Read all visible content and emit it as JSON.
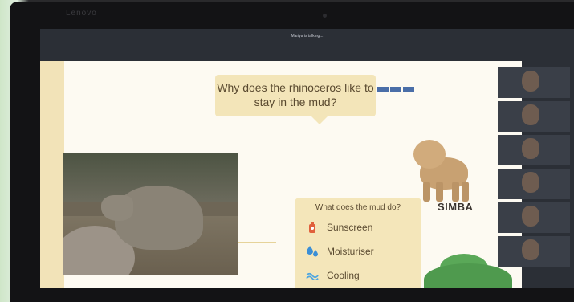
{
  "device": {
    "brand": "Lenovo"
  },
  "meeting": {
    "status": "Mariya is talking..."
  },
  "slide": {
    "question": "Why does the rhinoceros like to stay in the mud?",
    "character_name": "SIMBA",
    "card": {
      "heading": "What does the mud do?",
      "items": [
        {
          "icon": "sunscreen-bottle-icon",
          "label": "Sunscreen",
          "color": "#e0603c"
        },
        {
          "icon": "water-drops-icon",
          "label": "Moisturiser",
          "color": "#3b8fd6"
        },
        {
          "icon": "wave-icon",
          "label": "Cooling",
          "color": "#4ea6e0"
        }
      ]
    }
  },
  "participants": [
    {
      "name": ""
    },
    {
      "name": ""
    },
    {
      "name": ""
    },
    {
      "name": ""
    },
    {
      "name": ""
    },
    {
      "name": ""
    }
  ],
  "colors": {
    "slide_bg": "#fdfaf2",
    "card_bg": "#f4e6ba",
    "text": "#5a4a30"
  }
}
